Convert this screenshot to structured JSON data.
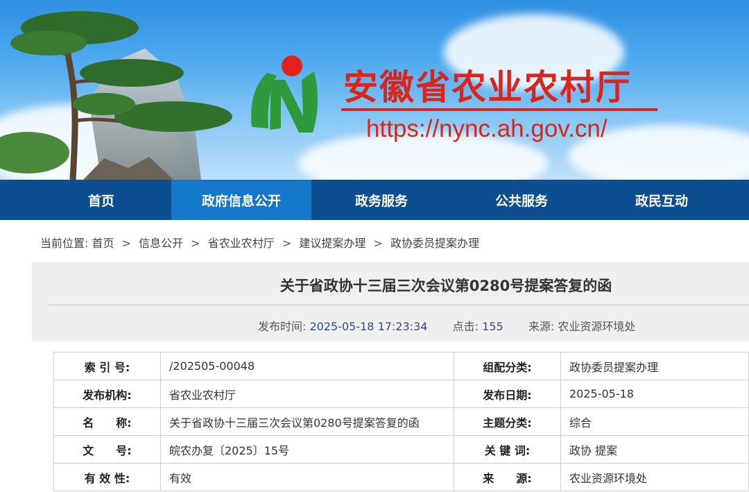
{
  "banner": {
    "site_title": "安徽省农业农村厅",
    "site_url": "https://nync.ah.gov.cn/"
  },
  "nav": {
    "items": [
      {
        "label": "首页",
        "active": false
      },
      {
        "label": "政府信息公开",
        "active": true
      },
      {
        "label": "政务服务",
        "active": false
      },
      {
        "label": "公共服务",
        "active": false
      },
      {
        "label": "政民互动",
        "active": false
      }
    ]
  },
  "breadcrumb": {
    "prefix": "当前位置:",
    "items": [
      "首页",
      "信息公开",
      "省农业农村厅",
      "建议提案办理",
      "政协委员提案办理"
    ],
    "separator": ">"
  },
  "article": {
    "title": "关于省政协十三届三次会议第0280号提案答复的函",
    "publish_time_label": "发布时间:",
    "publish_time": "2025-05-18 17:23:34",
    "clicks_label": "点击:",
    "clicks": "155",
    "source_label": "来源:",
    "source": "农业资源环境处"
  },
  "info_table": {
    "rows": [
      {
        "k1": "索 引 号:",
        "v1": "/202505-00048",
        "k2": "组配分类:",
        "v2": "政协委员提案办理"
      },
      {
        "k1": "发布机构:",
        "v1": "省农业农村厅",
        "k2": "发布日期:",
        "v2": "2025-05-18"
      },
      {
        "k1": "名　　称:",
        "v1": "关于省政协十三届三次会议第0280号提案答复的函",
        "k2": "主题分类:",
        "v2": "综合"
      },
      {
        "k1": "文　　号:",
        "v1": "皖农办复〔2025〕15号",
        "k2": "关 键 词:",
        "v2": "政协 提案"
      },
      {
        "k1": "有 效 性:",
        "v1": "有效",
        "k2": "来　　源:",
        "v2": "农业资源环境处"
      }
    ]
  },
  "colors": {
    "brand_red": "#d9251c",
    "nav_bg": "#0c4e8f",
    "nav_active": "#1577c9",
    "meta_value": "#2c4a9a"
  }
}
